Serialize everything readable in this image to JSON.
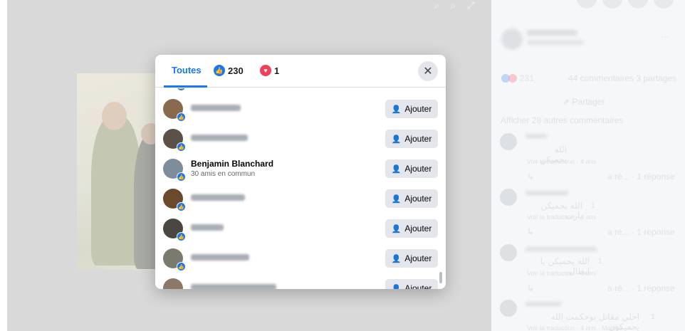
{
  "modal": {
    "tabs": [
      {
        "label": "Toutes"
      },
      {
        "label": "230",
        "icon": "like-icon"
      },
      {
        "label": "1",
        "icon": "love-icon"
      }
    ],
    "add_label": "Ajouter",
    "people": [
      {
        "name": "",
        "mutual": ""
      },
      {
        "name": "",
        "mutual": ""
      },
      {
        "name": "Benjamin Blanchard",
        "mutual": "30 amis en commun"
      },
      {
        "name": "",
        "mutual": ""
      },
      {
        "name": "",
        "mutual": ""
      },
      {
        "name": "",
        "mutual": ""
      },
      {
        "name": "",
        "mutual": ""
      }
    ]
  },
  "sidebar": {
    "reactions_count": "231",
    "comments_shares": "44 commentaires  3 partages",
    "share_label": "Partager",
    "more_comments": "Afficher 28 autres commentaires",
    "comments": [
      {
        "text": "الله يحميكن",
        "translate": "Voir la traduction · 4 ans",
        "reply": "a ré... · 1 réponse"
      },
      {
        "text": "الله يحميكن يارب",
        "translate": "Voir la traduction · 4 ans",
        "reply": "a ré... · 1 réponse",
        "likes": "1"
      },
      {
        "text": "الله يحميكن يا ابطال",
        "translate": "Voir la traduction · 4 ans",
        "reply": "a ré... · 1 réponse",
        "likes": "1"
      },
      {
        "text": "احلي مقاتل بوحكمت الله يحميكون",
        "translate": "Voir la traduction · 4 ans · Modifié",
        "likes": "1"
      }
    ]
  }
}
